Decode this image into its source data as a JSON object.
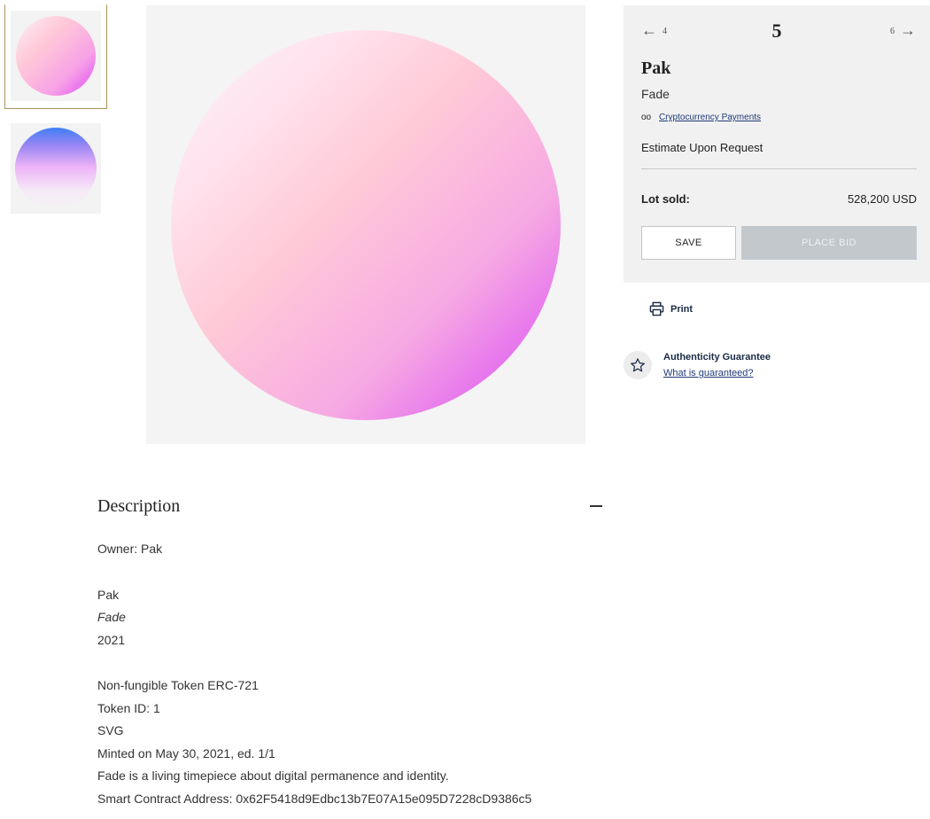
{
  "thumbnails": [
    {
      "name": "thumbnail-fade",
      "active": true
    },
    {
      "name": "thumbnail-blue",
      "active": false
    }
  ],
  "lot_nav": {
    "prev_arrow": "←",
    "prev_number": "4",
    "current_number": "5",
    "next_number": "6",
    "next_arrow": "→"
  },
  "lot": {
    "artist": "Pak",
    "title": "Fade",
    "crypto_icon": "oo",
    "crypto_link": "Cryptocurrency Payments",
    "estimate": "Estimate Upon Request",
    "sold_label": "Lot sold:",
    "sold_value": "528,200 USD"
  },
  "actions": {
    "save_label": "SAVE",
    "bid_label": "PLACE BID",
    "print_label": "Print"
  },
  "authenticity": {
    "title": "Authenticity Guarantee",
    "link": "What is guaranteed?"
  },
  "description": {
    "heading": "Description",
    "lines": [
      "Owner: Pak",
      "Pak",
      "Fade",
      "2021",
      "Non-fungible Token ERC-721",
      "Token ID: 1",
      "SVG",
      "Minted on May 30, 2021, ed. 1/1",
      "Fade is a living timepiece about digital permanence and identity.",
      "Smart Contract Address: 0x62F5418d9Edbc13b7E07A15e095D7228cD9386c5"
    ]
  },
  "colors": {
    "panel_bg": "#f1f1f1",
    "link": "#1f3a78",
    "thumbnail_border": "#a8925b",
    "bid_disabled": "#c3c8cd"
  }
}
